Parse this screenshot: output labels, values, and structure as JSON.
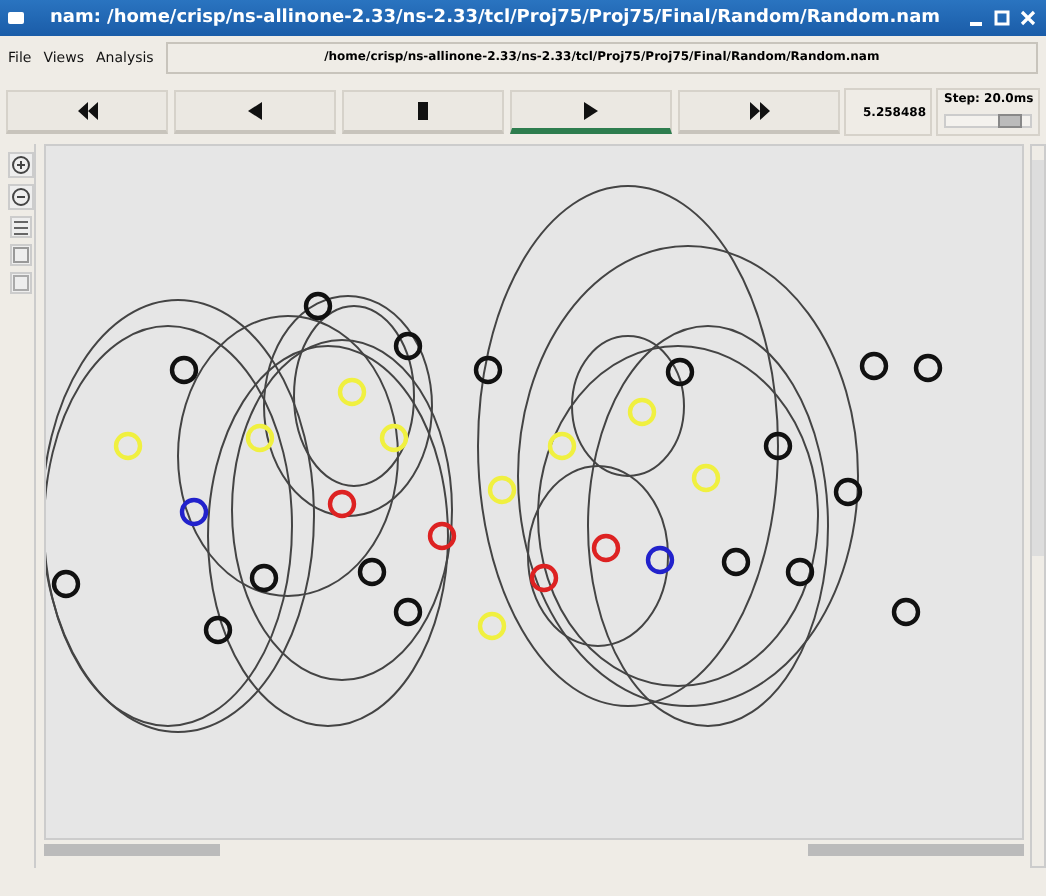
{
  "window": {
    "title": "nam: /home/crisp/ns-allinone-2.33/ns-2.33/tcl/Proj75/Proj75/Final/Random/Random.nam"
  },
  "menu": [
    "File",
    "Views",
    "Analysis"
  ],
  "file_path": "/home/crisp/ns-allinone-2.33/ns-2.33/tcl/Proj75/Proj75/Final/Random/Random.nam",
  "controls": [
    {
      "kind": "rewind",
      "selected": false
    },
    {
      "kind": "back",
      "selected": false
    },
    {
      "kind": "stop",
      "selected": false
    },
    {
      "kind": "play",
      "selected": true
    },
    {
      "kind": "forward",
      "selected": false
    }
  ],
  "time": "5.258488",
  "step": {
    "label": "Step: 20.0ms",
    "level": 0.85
  },
  "nodes": [
    {
      "color": "#111111"
    },
    {
      "color": "#111111"
    },
    {
      "color": "#111111"
    },
    {
      "color": "#111111"
    },
    {
      "color": "#111111"
    },
    {
      "color": "#111111"
    },
    {
      "color": "#111111"
    },
    {
      "color": "#111111"
    },
    {
      "color": "#111111"
    },
    {
      "color": "#111111"
    },
    {
      "color": "#111111"
    },
    {
      "color": "#111111"
    },
    {
      "color": "#111111"
    },
    {
      "color": "#111111"
    },
    {
      "color": "#111111"
    },
    {
      "color": "#111111"
    },
    {
      "color": "#111111"
    },
    {
      "color": "#f0f040"
    },
    {
      "color": "#f0f040"
    },
    {
      "color": "#f0f040"
    },
    {
      "color": "#f0f040"
    },
    {
      "color": "#f0f040"
    },
    {
      "color": "#f0f040"
    },
    {
      "color": "#f0f040"
    },
    {
      "color": "#f0f040"
    },
    {
      "color": "#f0f040"
    },
    {
      "color": "#dd2222"
    },
    {
      "color": "#dd2222"
    },
    {
      "color": "#dd2222"
    },
    {
      "color": "#dd2222"
    },
    {
      "color": "#2222cc"
    },
    {
      "color": "#2222cc"
    }
  ]
}
